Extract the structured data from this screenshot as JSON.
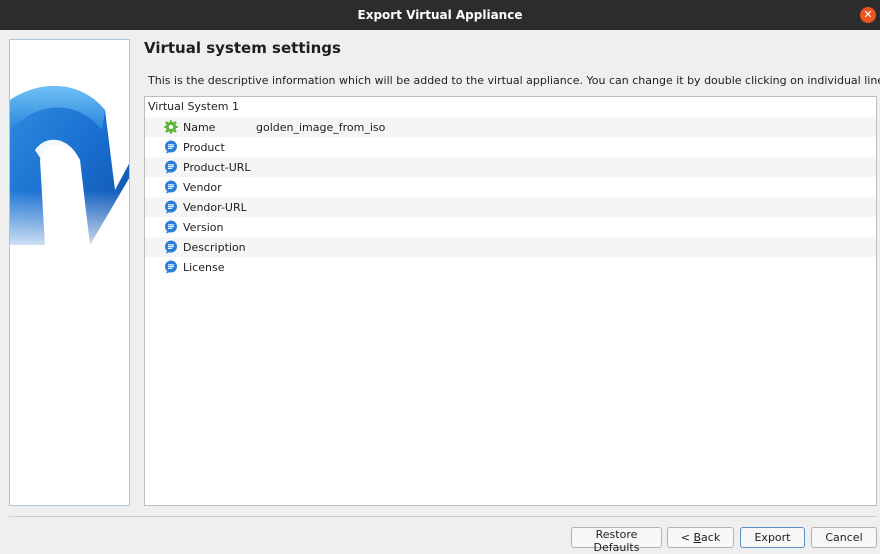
{
  "window": {
    "title": "Export Virtual Appliance",
    "close_icon": "close-icon"
  },
  "page": {
    "heading": "Virtual system settings",
    "description": "This is the descriptive information which will be added to the virtual appliance. You can change it by double clicking on individual lines."
  },
  "tree": {
    "root_label": "Virtual System 1",
    "rows": [
      {
        "key": "Name",
        "value": "golden_image_from_iso",
        "icon": "green-gear-icon"
      },
      {
        "key": "Product",
        "value": "",
        "icon": "speech-bubble-icon"
      },
      {
        "key": "Product-URL",
        "value": "",
        "icon": "speech-bubble-icon"
      },
      {
        "key": "Vendor",
        "value": "",
        "icon": "speech-bubble-icon"
      },
      {
        "key": "Vendor-URL",
        "value": "",
        "icon": "speech-bubble-icon"
      },
      {
        "key": "Version",
        "value": "",
        "icon": "speech-bubble-icon"
      },
      {
        "key": "Description",
        "value": "",
        "icon": "speech-bubble-icon"
      },
      {
        "key": "License",
        "value": "",
        "icon": "speech-bubble-icon"
      }
    ]
  },
  "buttons": {
    "restore_defaults": "Restore Defaults",
    "back_prefix": "< ",
    "back_mnemonic": "B",
    "back_rest": "ack",
    "export": "Export",
    "cancel": "Cancel"
  },
  "colors": {
    "titlebar": "#2c2c2c",
    "close": "#e95420",
    "accent": "#5a8fc7"
  }
}
